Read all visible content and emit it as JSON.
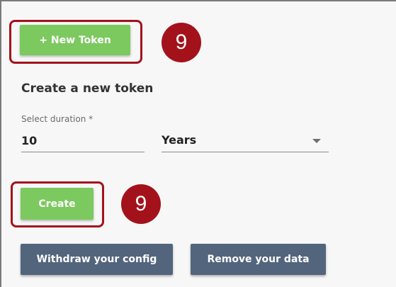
{
  "actions": {
    "new_token_label": "+ New Token",
    "create_label": "Create",
    "withdraw_config_label": "Withdraw your config",
    "remove_data_label": "Remove your data"
  },
  "form": {
    "title": "Create a new token",
    "duration_label": "Select duration *",
    "duration_value": "10",
    "unit_value": "Years"
  },
  "annotations": {
    "step_badge_1": "9",
    "step_badge_2": "9"
  },
  "colors": {
    "accent_green": "#7cc95f",
    "secondary_button": "#53657d",
    "highlight_red": "#a3121b"
  }
}
